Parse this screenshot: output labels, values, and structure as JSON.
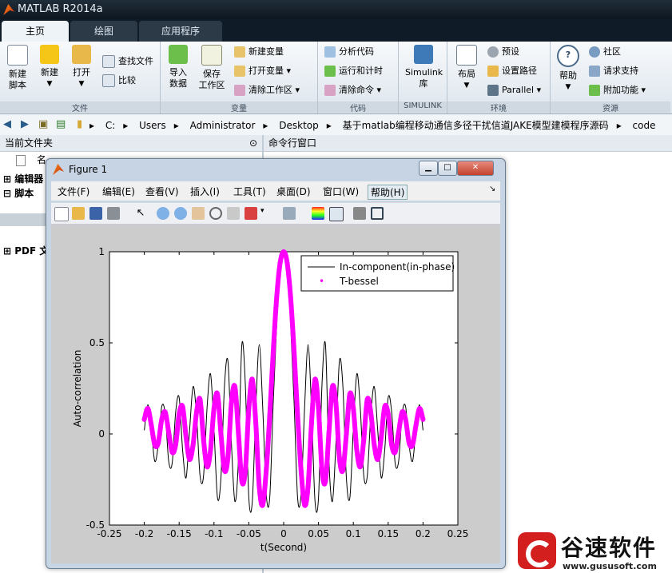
{
  "app": {
    "title": "MATLAB R2014a"
  },
  "tabs": [
    "主页",
    "绘图",
    "应用程序"
  ],
  "ribbon": {
    "file_group": {
      "label": "文件",
      "new_script": "新建\n脚本",
      "new": "新建",
      "open": "打开",
      "find_files": "查找文件",
      "compare": "比较"
    },
    "variable_group": {
      "label": "变量",
      "import": "导入\n数据",
      "save_ws": "保存\n工作区",
      "new_var": "新建变量",
      "open_var": "打开变量",
      "clear_ws": "清除工作区"
    },
    "code_group": {
      "label": "代码",
      "analyze": "分析代码",
      "run_time": "运行和计时",
      "clear_cmd": "清除命令"
    },
    "simulink_group": {
      "label": "SIMULINK",
      "lib": "Simulink\n库"
    },
    "env_group": {
      "label": "环境",
      "layout": "布局",
      "prefs": "预设",
      "set_path": "设置路径",
      "parallel": "Parallel"
    },
    "res_group": {
      "label": "资源",
      "help": "帮助",
      "community": "社区",
      "request_support": "请求支持",
      "addons": "附加功能"
    }
  },
  "address": {
    "crumbs": [
      "C:",
      "Users",
      "Administrator",
      "Desktop",
      "基于matlab编程移动通信多径干扰信道JAKE模型建模程序源码",
      "code"
    ]
  },
  "left_pane": {
    "title": "当前文件夹",
    "col": "名",
    "tree": [
      "编辑器",
      "脚本",
      "PDF 文"
    ]
  },
  "right_pane": {
    "title": "命令行窗口"
  },
  "figure": {
    "title": "Figure 1",
    "menu": [
      "文件(F)",
      "编辑(E)",
      "查看(V)",
      "插入(I)",
      "工具(T)",
      "桌面(D)",
      "窗口(W)",
      "帮助(H)"
    ]
  },
  "chart_data": {
    "type": "line",
    "title": "",
    "xlabel": "t(Second)",
    "ylabel": "Auto-correlation",
    "xlim": [
      -0.25,
      0.25
    ],
    "ylim": [
      -0.5,
      1
    ],
    "xticks": [
      "-0.25",
      "-0.2",
      "-0.15",
      "-0.1",
      "-0.05",
      "0",
      "0.05",
      "0.1",
      "0.15",
      "0.2",
      "0.25"
    ],
    "yticks": [
      "-0.5",
      "0",
      "0.5",
      "1"
    ],
    "legend_position": "top-right",
    "series": [
      {
        "name": "In-component(in-phase)",
        "style": "black-line",
        "color": "#000000",
        "x": [
          -0.2,
          -0.195,
          -0.19,
          -0.185,
          -0.18,
          -0.175,
          -0.17,
          -0.165,
          -0.16,
          -0.155,
          -0.15,
          -0.145,
          -0.14,
          -0.135,
          -0.13,
          -0.125,
          -0.12,
          -0.115,
          -0.11,
          -0.105,
          -0.1,
          -0.095,
          -0.09,
          -0.085,
          -0.08,
          -0.075,
          -0.07,
          -0.065,
          -0.06,
          -0.055,
          -0.05,
          -0.045,
          -0.04,
          -0.035,
          -0.03,
          -0.025,
          -0.02,
          -0.015,
          -0.01,
          -0.005,
          0,
          0.005,
          0.01,
          0.015,
          0.02,
          0.025,
          0.03,
          0.035,
          0.04,
          0.045,
          0.05,
          0.055,
          0.06,
          0.065,
          0.07,
          0.075,
          0.08,
          0.085,
          0.09,
          0.095,
          0.1,
          0.105,
          0.11,
          0.115,
          0.12,
          0.125,
          0.13,
          0.135,
          0.14,
          0.145,
          0.15,
          0.155,
          0.16,
          0.165,
          0.17,
          0.175,
          0.18,
          0.185,
          0.19,
          0.195,
          0.2
        ],
        "y": [
          0.02,
          0.16,
          0.03,
          -0.15,
          -0.06,
          0.15,
          0.11,
          -0.15,
          -0.16,
          0.12,
          0.2,
          -0.09,
          -0.24,
          0.02,
          0.26,
          0.1,
          -0.23,
          -0.23,
          0.14,
          0.33,
          0.03,
          -0.35,
          -0.24,
          0.26,
          0.4,
          -0.05,
          -0.37,
          -0.15,
          0.49,
          0.27,
          -0.35,
          -0.37,
          0.14,
          0.49,
          0.14,
          -0.33,
          -0.35,
          0.17,
          0.6,
          0.9,
          1.0,
          0.9,
          0.6,
          0.17,
          -0.35,
          -0.33,
          0.14,
          0.49,
          0.14,
          -0.37,
          -0.35,
          0.27,
          0.49,
          -0.15,
          -0.37,
          -0.05,
          0.4,
          0.26,
          -0.24,
          -0.35,
          0.03,
          0.33,
          0.14,
          -0.23,
          -0.23,
          0.1,
          0.26,
          0.02,
          -0.24,
          -0.09,
          0.2,
          0.12,
          -0.16,
          -0.15,
          0.11,
          0.15,
          -0.06,
          -0.15,
          0.03,
          0.16,
          0.02
        ]
      },
      {
        "name": "T-bessel",
        "style": "magenta-dots",
        "color": "#ff00ff",
        "x": [
          -0.2,
          -0.195,
          -0.19,
          -0.185,
          -0.18,
          -0.175,
          -0.17,
          -0.165,
          -0.16,
          -0.155,
          -0.15,
          -0.145,
          -0.14,
          -0.135,
          -0.13,
          -0.125,
          -0.12,
          -0.115,
          -0.11,
          -0.105,
          -0.1,
          -0.095,
          -0.09,
          -0.085,
          -0.08,
          -0.075,
          -0.07,
          -0.065,
          -0.06,
          -0.055,
          -0.05,
          -0.045,
          -0.04,
          -0.035,
          -0.03,
          -0.025,
          -0.02,
          -0.015,
          -0.01,
          -0.005,
          0,
          0.005,
          0.01,
          0.015,
          0.02,
          0.025,
          0.03,
          0.035,
          0.04,
          0.045,
          0.05,
          0.055,
          0.06,
          0.065,
          0.07,
          0.075,
          0.08,
          0.085,
          0.09,
          0.095,
          0.1,
          0.105,
          0.11,
          0.115,
          0.12,
          0.125,
          0.13,
          0.135,
          0.14,
          0.145,
          0.15,
          0.155,
          0.16,
          0.165,
          0.17,
          0.175,
          0.18,
          0.185,
          0.19,
          0.195,
          0.2
        ],
        "y": [
          0.08,
          0.14,
          0.05,
          -0.06,
          -0.05,
          0.08,
          0.12,
          0.01,
          -0.1,
          -0.06,
          0.11,
          0.15,
          -0.02,
          -0.14,
          -0.06,
          0.12,
          0.19,
          -0.03,
          -0.18,
          -0.09,
          0.14,
          0.22,
          0.0,
          -0.2,
          -0.13,
          0.17,
          0.26,
          0.01,
          -0.26,
          -0.2,
          0.14,
          0.3,
          0.06,
          -0.29,
          -0.39,
          -0.2,
          0.1,
          0.45,
          0.75,
          0.94,
          1.0,
          0.94,
          0.75,
          0.45,
          0.1,
          -0.2,
          -0.39,
          -0.29,
          0.06,
          0.3,
          0.14,
          -0.2,
          -0.26,
          0.01,
          0.26,
          0.17,
          -0.13,
          -0.2,
          0.0,
          0.22,
          0.14,
          -0.09,
          -0.18,
          -0.03,
          0.19,
          0.12,
          -0.06,
          -0.14,
          -0.02,
          0.15,
          0.11,
          -0.06,
          -0.1,
          0.01,
          0.12,
          0.08,
          -0.05,
          -0.06,
          0.05,
          0.14,
          0.08
        ]
      }
    ]
  },
  "watermark": {
    "text": "谷速软件",
    "url": "www.gususoft.com"
  }
}
